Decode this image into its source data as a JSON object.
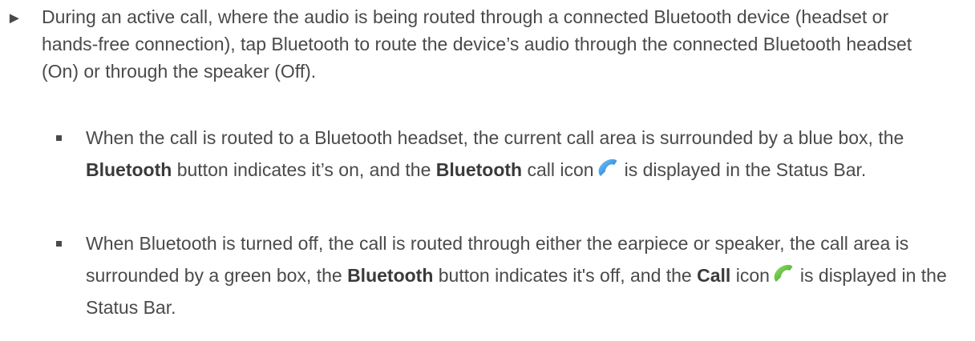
{
  "lead": {
    "arrow": "►",
    "text": "During an active call, where the audio is being routed through a connected Bluetooth device (headset or hands-free connection), tap Bluetooth to route the device’s audio through the connected Bluetooth headset (On) or through the speaker (Off)."
  },
  "items": [
    {
      "part1": "When the call is routed to a Bluetooth headset, the current call area is surrounded by a blue box, the ",
      "bold1": "Bluetooth",
      "part2": " button indicates it’s on, and the ",
      "bold2": "Bluetooth",
      "part3": " call icon",
      "part4": "is displayed in the Status Bar.",
      "icon": "bluetooth-call-icon",
      "icon_color": "#1f8fe0"
    },
    {
      "part1": "When Bluetooth is turned off, the call is routed through either the earpiece or speaker, the call area is surrounded by a green box, the ",
      "bold1": "Bluetooth",
      "part2": " button indicates it's off, and the ",
      "bold2": "Call",
      "part3": " icon",
      "part4": "is displayed in the Status Bar.",
      "icon": "call-icon",
      "icon_color": "#44b52a"
    }
  ]
}
